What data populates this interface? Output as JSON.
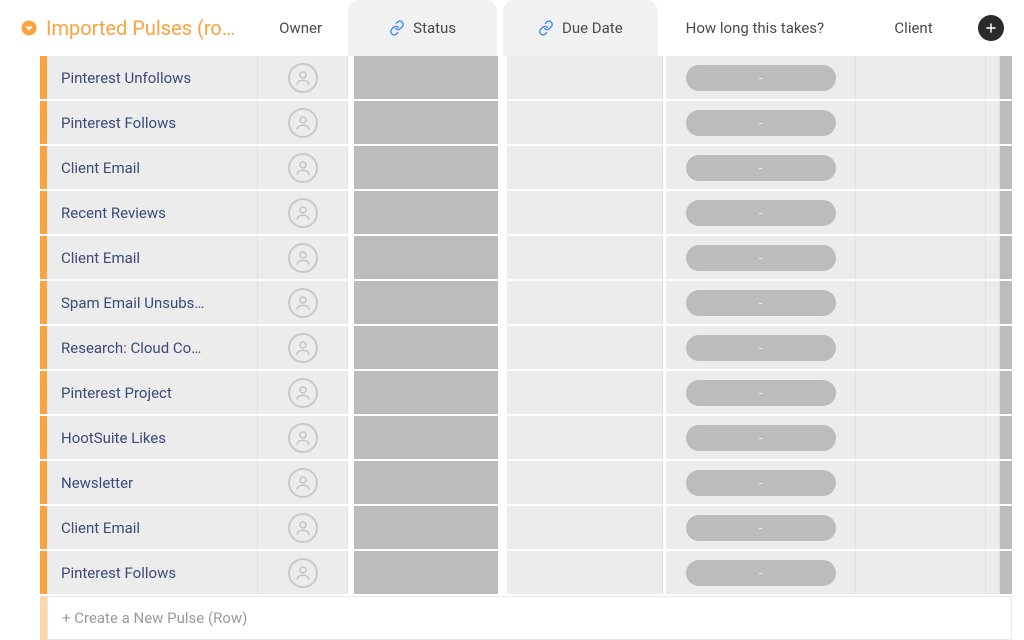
{
  "group": {
    "title": "Imported Pulses (ro…",
    "color": "#fca23e"
  },
  "columns": {
    "owner": "Owner",
    "status": "Status",
    "due": "Due Date",
    "duration": "How long this takes?",
    "client": "Client"
  },
  "rows": [
    {
      "name": "Pinterest Unfollows",
      "duration": "-"
    },
    {
      "name": "Pinterest Follows",
      "duration": "-"
    },
    {
      "name": "Client Email",
      "duration": "-"
    },
    {
      "name": "Recent Reviews",
      "duration": "-"
    },
    {
      "name": "Client Email",
      "duration": "-"
    },
    {
      "name": "Spam Email Unsubs…",
      "duration": "-"
    },
    {
      "name": "Research: Cloud Co…",
      "duration": "-"
    },
    {
      "name": "Pinterest Project",
      "duration": "-"
    },
    {
      "name": "HootSuite Likes",
      "duration": "-"
    },
    {
      "name": "Newsletter",
      "duration": "-"
    },
    {
      "name": "Client Email",
      "duration": "-"
    },
    {
      "name": "Pinterest Follows",
      "duration": "-"
    }
  ],
  "newRow": {
    "placeholder": "+ Create a New Pulse (Row)"
  }
}
